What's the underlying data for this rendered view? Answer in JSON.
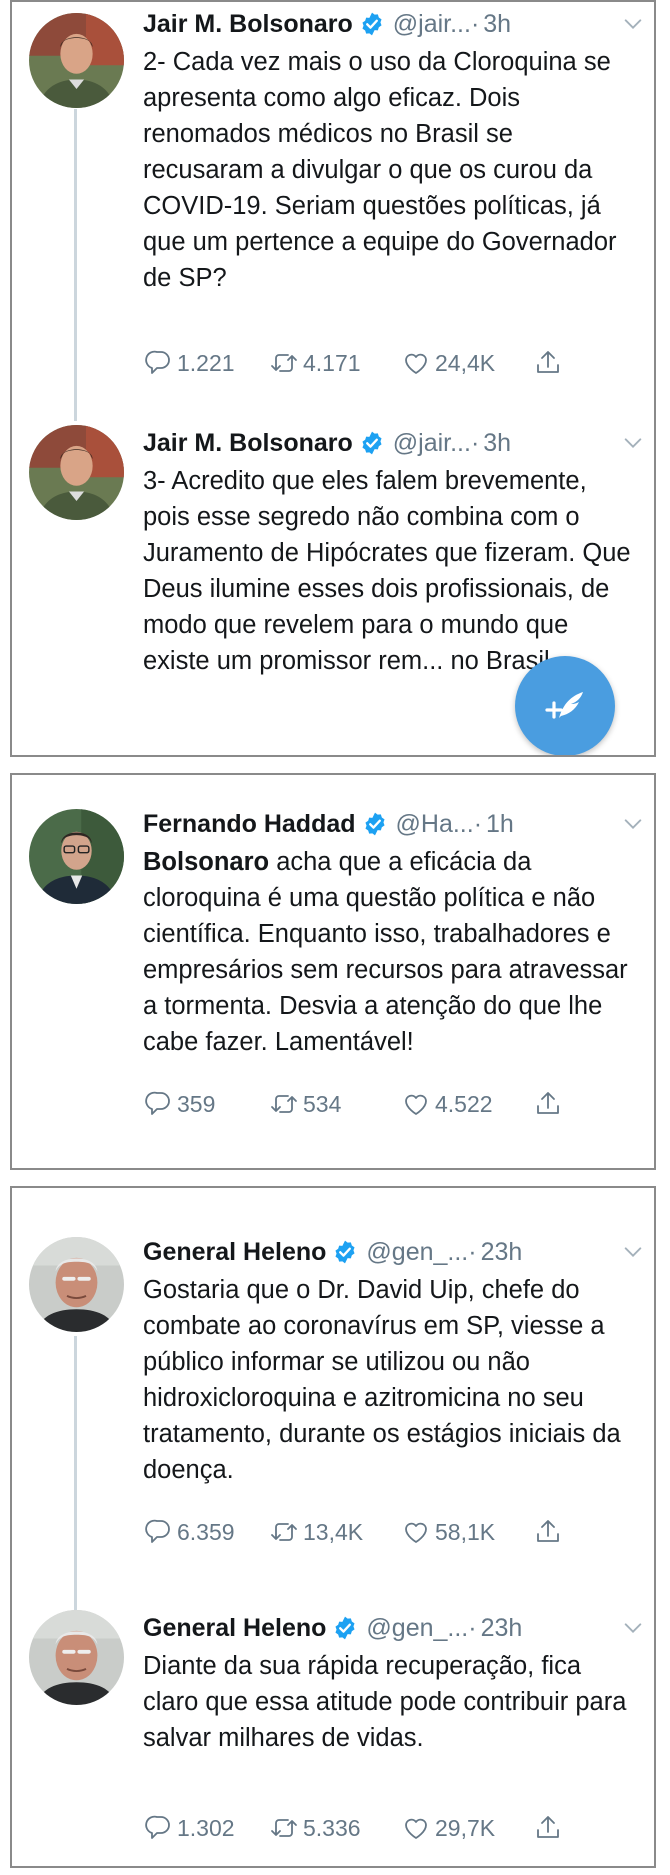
{
  "panels": [
    {
      "tweets": [
        {
          "name": "Jair M. Bolsonaro",
          "handle": "@jair...",
          "time": "3h",
          "text": "2- Cada vez mais o uso da Cloroquina se apresenta como algo eficaz. Dois renomados médicos no Brasil se recusaram a divulgar o que os curou da COVID-19. Seriam questões políticas, já que um pertence a equipe do Governador de SP?",
          "replies": "1.221",
          "retweets": "4.171",
          "likes": "24,4K"
        },
        {
          "name": "Jair M. Bolsonaro",
          "handle": "@jair...",
          "time": "3h",
          "text": "3- Acredito que eles falem brevemente, pois esse segredo não combina com o Juramento de Hipócrates que fizeram. Que Deus ilumine esses dois profissionais, de modo que revelem para o mundo que existe um promissor rem... no Brasil."
        }
      ]
    },
    {
      "tweets": [
        {
          "name": "Fernando Haddad",
          "handle": "@Ha...",
          "time": "1h",
          "mention": "Bolsonaro",
          "text": "acha que a eficácia da cloroquina é uma questão política e não científica. Enquanto isso, trabalhadores e empresários sem recursos para atravessar a tormenta. Desvia a atenção do que lhe cabe fazer. Lamentável!",
          "replies": "359",
          "retweets": "534",
          "likes": "4.522"
        }
      ]
    },
    {
      "tweets": [
        {
          "name": "General Heleno",
          "handle": "@gen_...",
          "time": "23h",
          "text": "Gostaria que o Dr. David Uip, chefe do combate ao coronavírus em SP, viesse a público informar se utilizou ou não hidroxicloroquina e azitromicina no seu tratamento, durante os estágios iniciais da doença.",
          "replies": "6.359",
          "retweets": "13,4K",
          "likes": "58,1K"
        },
        {
          "name": "General Heleno",
          "handle": "@gen_...",
          "time": "23h",
          "text": "Diante da sua rápida recuperação, fica claro que essa atitude pode contribuir para salvar milhares de vidas.",
          "replies": "1.302",
          "retweets": "5.336",
          "likes": "29,7K"
        }
      ]
    }
  ],
  "dot_separator": "·",
  "colors": {
    "verified": "#1da1f2",
    "secondary_text": "#657786",
    "fab": "#4a9de0",
    "thread_line": "#ccd6dd"
  },
  "icons": {
    "reply": "reply-icon",
    "retweet": "retweet-icon",
    "like": "heart-icon",
    "share": "share-icon",
    "compose": "compose-tweet-icon"
  }
}
